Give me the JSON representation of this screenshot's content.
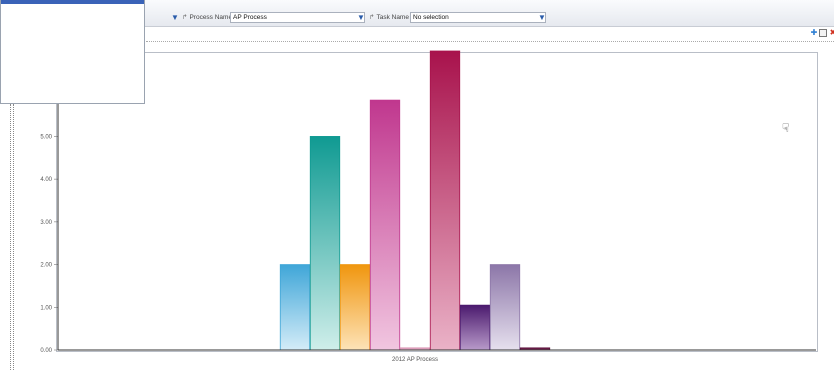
{
  "filters": {
    "process": {
      "label": "Process Name",
      "value": "AP Process"
    },
    "task": {
      "label": "Task Name",
      "value": "No selection"
    }
  },
  "icons": [
    "dropdown-arrow-icon",
    "dimension-icon",
    "add-icon",
    "table-icon",
    "close-icon",
    "hand-cursor-icon"
  ],
  "colors": {
    "accent": "#3a63b8",
    "axis": "#333333"
  },
  "chart_data": {
    "type": "bar",
    "categories": [
      "2012 AP Process"
    ],
    "series": [
      {
        "values": [
          2.0
        ],
        "color_top": "#3fa6d8",
        "color_bottom": "#d4ecf8"
      },
      {
        "values": [
          5.0
        ],
        "color_top": "#0f9a92",
        "color_bottom": "#cfeeea"
      },
      {
        "values": [
          2.0
        ],
        "color_top": "#f0960e",
        "color_bottom": "#fde3b8"
      },
      {
        "values": [
          5.85
        ],
        "color_top": "#c0378e",
        "color_bottom": "#f1c6e0"
      },
      {
        "values": [
          0.05
        ],
        "color_top": "#d78fb0",
        "color_bottom": "#efc8da"
      },
      {
        "values": [
          7.0
        ],
        "color_top": "#a8124c",
        "color_bottom": "#eab2c7"
      },
      {
        "values": [
          1.05
        ],
        "color_top": "#4b1a6e",
        "color_bottom": "#b89ac9"
      },
      {
        "values": [
          2.0
        ],
        "color_top": "#8c76a8",
        "color_bottom": "#e6e0ee"
      },
      {
        "values": [
          0.05
        ],
        "color_top": "#5a0f3a",
        "color_bottom": "#8a3a66"
      }
    ],
    "ylim": [
      0,
      7.0
    ],
    "yticks": [
      "0.00",
      "1.00",
      "2.00",
      "3.00",
      "4.00",
      "5.00"
    ],
    "xlabel": "",
    "ylabel": "",
    "title": ""
  }
}
